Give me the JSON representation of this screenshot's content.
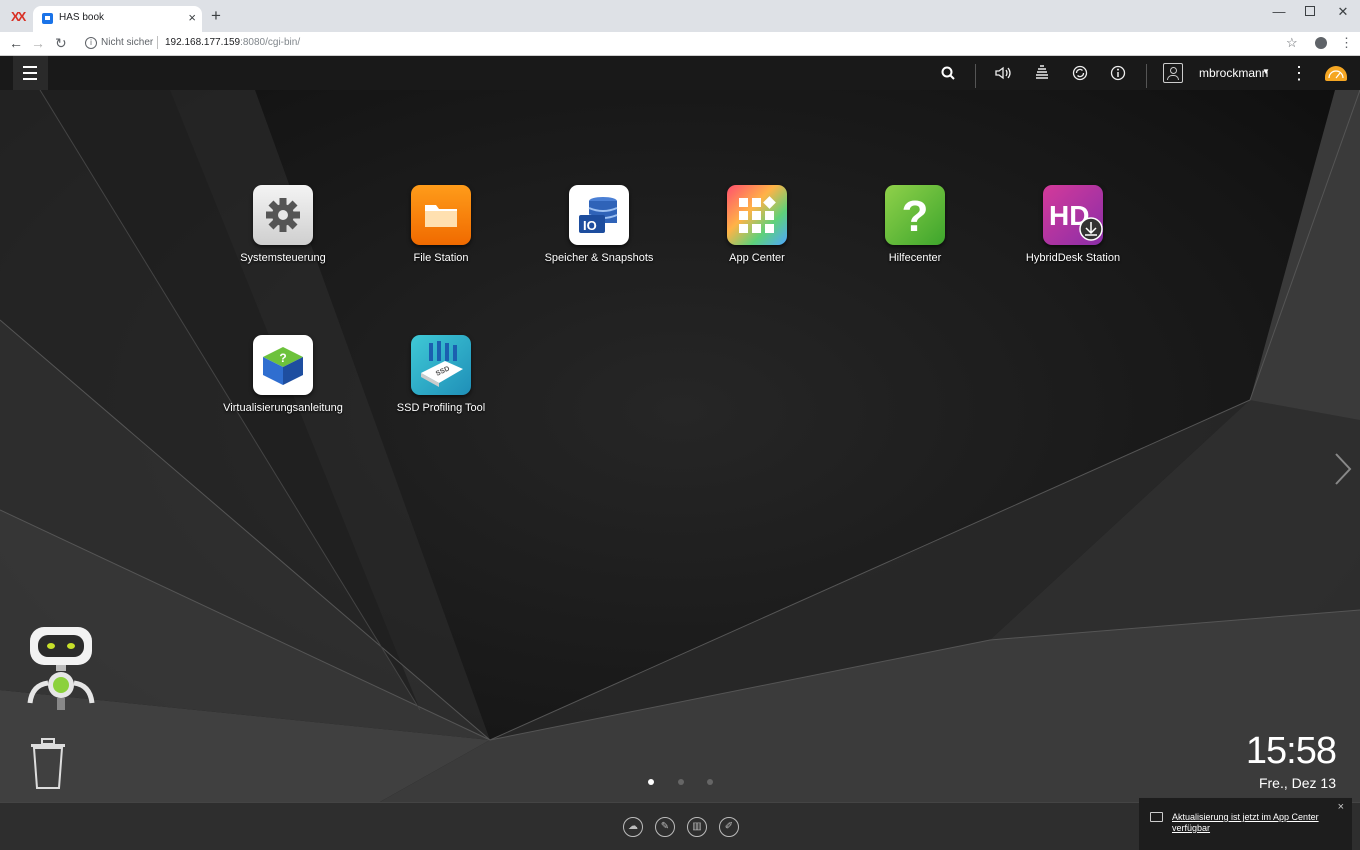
{
  "browser": {
    "tab_title": "HAS book",
    "tab_close": "×",
    "new_tab": "+",
    "not_secure": "Nicht sicher",
    "url_host": "192.168.177.159",
    "url_rest": ":8080/cgi-bin/"
  },
  "topbar": {
    "username": "mbrockmann",
    "icons": [
      "menu-icon",
      "search-icon",
      "volume-icon",
      "stack-icon",
      "sync-icon",
      "info-icon",
      "user-icon",
      "more-icon",
      "gauge-icon"
    ]
  },
  "apps": [
    {
      "label": "Systemsteuerung",
      "icon": "gear-icon"
    },
    {
      "label": "File Station",
      "icon": "folder-icon"
    },
    {
      "label": "Speicher & Snapshots",
      "icon": "storage-icon"
    },
    {
      "label": "App Center",
      "icon": "grid-icon"
    },
    {
      "label": "Hilfecenter",
      "icon": "question-icon"
    },
    {
      "label": "HybridDesk Station",
      "icon": "hd-icon"
    },
    {
      "label": "Virtualisierungsanleitung",
      "icon": "cube-icon"
    },
    {
      "label": "SSD Profiling Tool",
      "icon": "ssd-icon"
    }
  ],
  "clock": {
    "time": "15:58",
    "date": "Fre., Dez 13"
  },
  "pager": {
    "pages": 3,
    "active": 1
  },
  "notification": {
    "text": "Aktualisierung ist jetzt im App Center verfügbar",
    "close": "×"
  },
  "colors": {
    "accent": "#f5a623",
    "desktop": "#1a1a1a",
    "dock": "#2e2e2e"
  }
}
